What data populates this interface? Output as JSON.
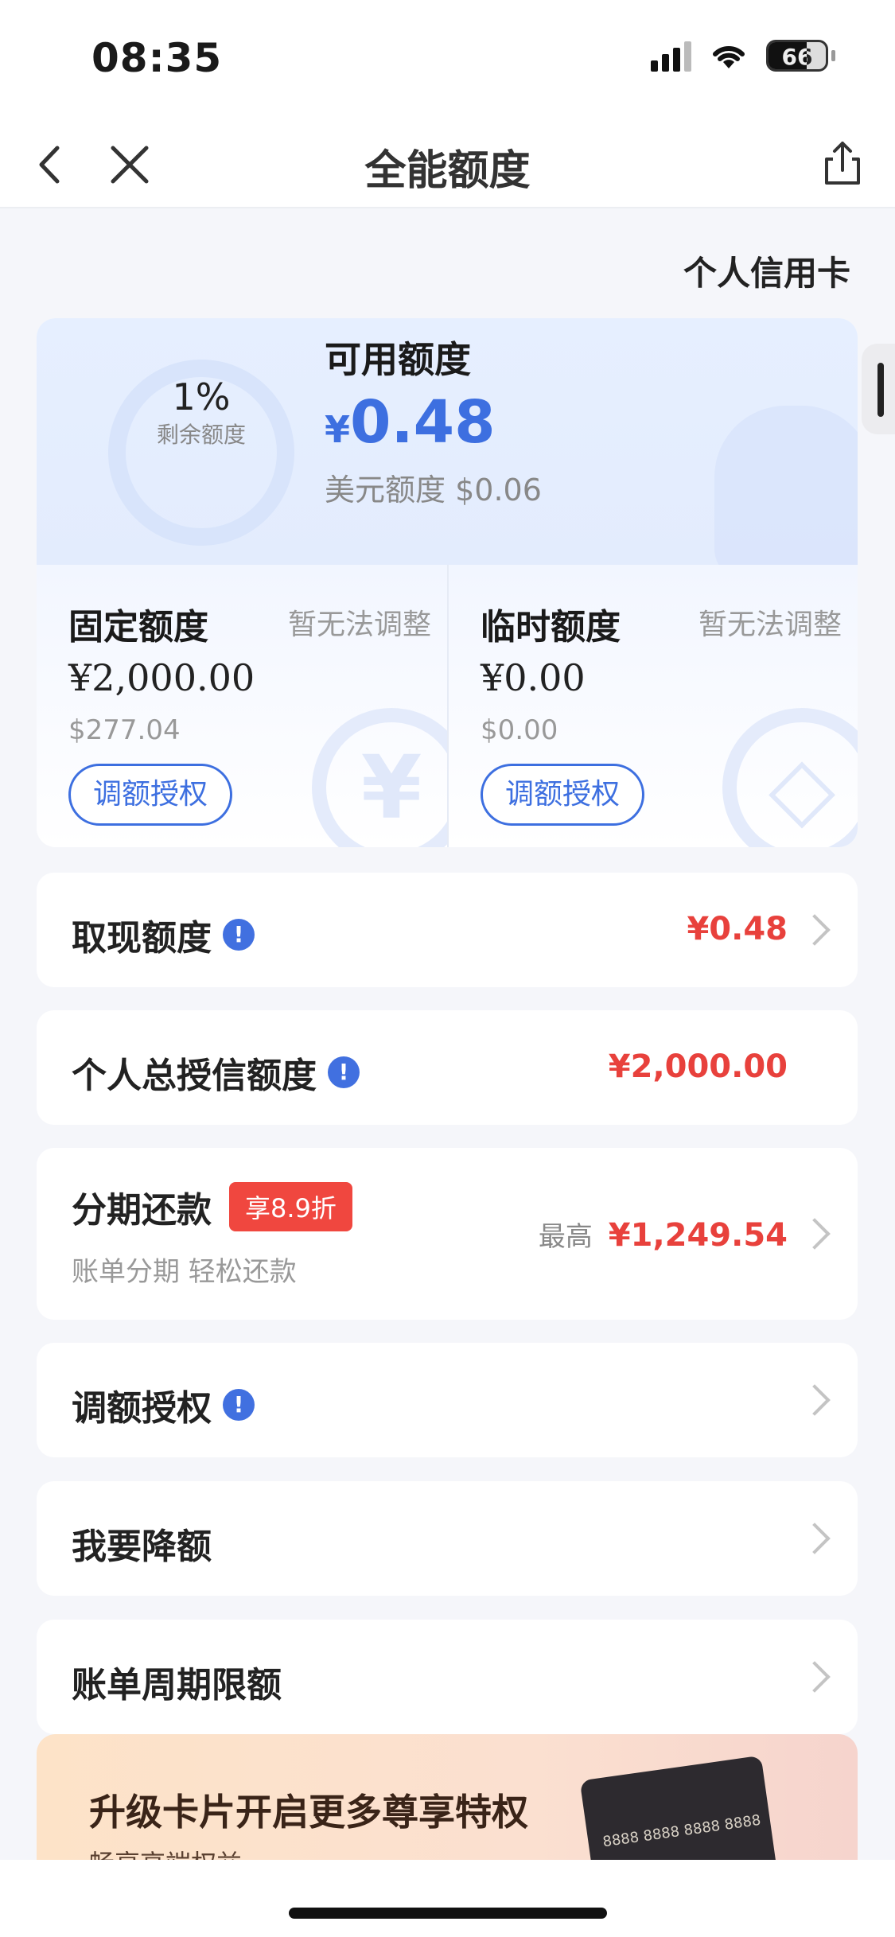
{
  "status_bar": {
    "time": "08:35",
    "battery": "66",
    "battery_level": 0.66
  },
  "nav": {
    "title": "全能额度"
  },
  "card_type": "个人信用卡",
  "summary": {
    "percent": "1%",
    "percent_label": "剩余额度",
    "available_label": "可用额度",
    "currency_symbol": "¥",
    "available_amount": "0.48",
    "usd_label": "美元额度",
    "usd_amount": "$0.06"
  },
  "fixed": {
    "title": "固定额度",
    "note": "暂无法调整",
    "amount": "¥2,000.00",
    "usd": "$277.04",
    "button": "调额授权"
  },
  "temporary": {
    "title": "临时额度",
    "note": "暂无法调整",
    "amount": "¥0.00",
    "usd": "$0.00",
    "button": "调额授权"
  },
  "rows": {
    "cash": {
      "label": "取现额度",
      "value": "¥0.48"
    },
    "total": {
      "label": "个人总授信额度",
      "value": "¥2,000.00"
    },
    "installment": {
      "label": "分期还款",
      "badge": "享8.9折",
      "sub": "账单分期 轻松还款",
      "max_label": "最高",
      "value": "¥1,249.54"
    },
    "authorize": {
      "label": "调额授权"
    },
    "reduce": {
      "label": "我要降额"
    },
    "cycle": {
      "label": "账单周期限额"
    }
  },
  "promo": {
    "title": "升级卡片开启更多尊享特权",
    "sub": "畅享高端权益",
    "card_number": "8888 8888 8888 8888"
  }
}
